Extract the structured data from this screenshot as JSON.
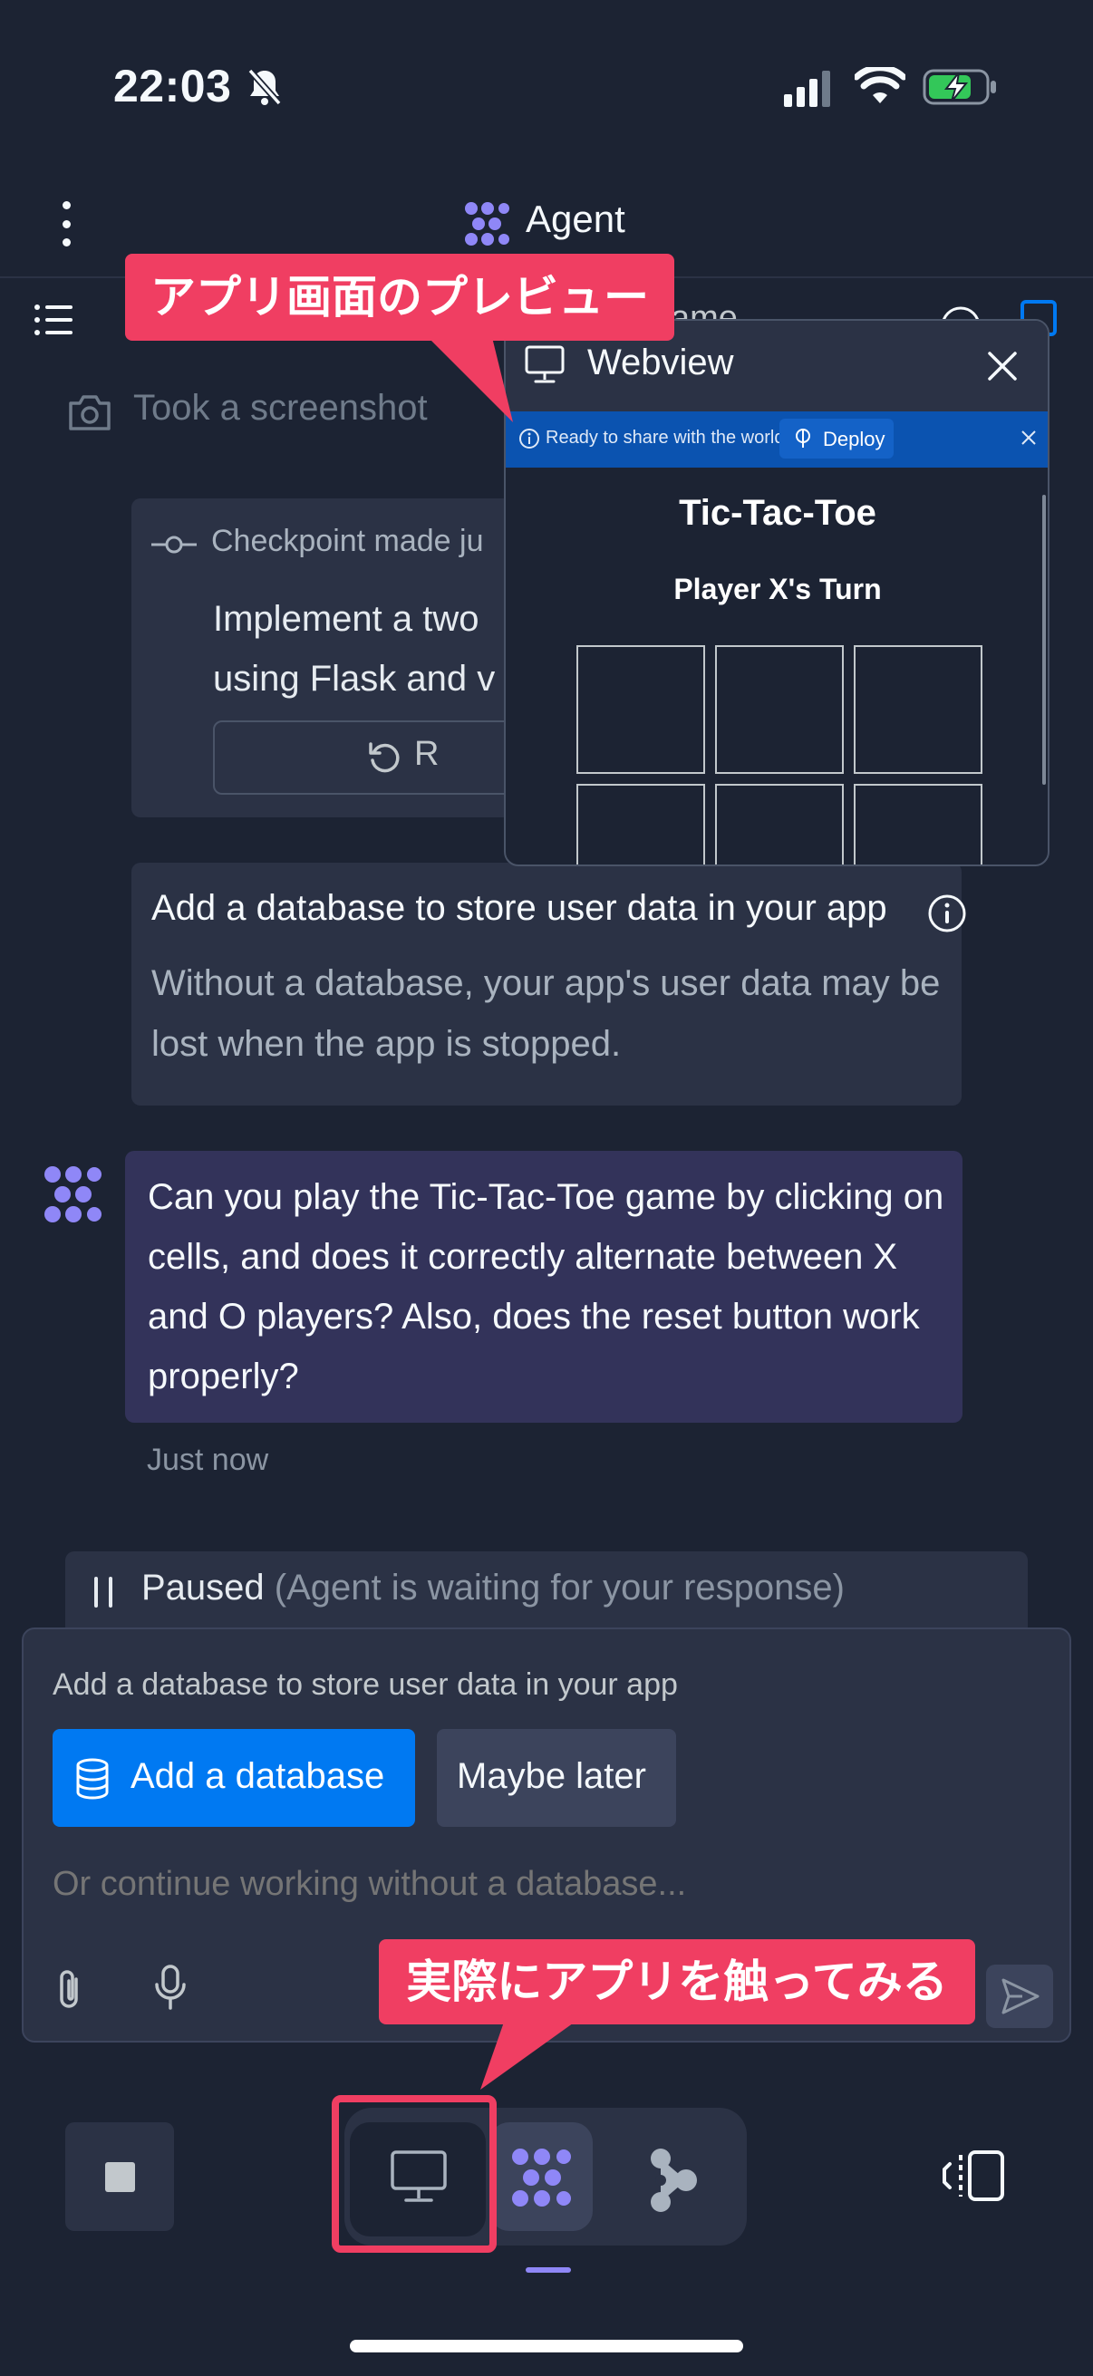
{
  "status_bar": {
    "time": "22:03"
  },
  "header": {
    "title": "Agent"
  },
  "subheader": {
    "visible_text": "ame"
  },
  "tool_action": {
    "label": "Took a screenshot"
  },
  "checkpoint": {
    "label": "Checkpoint made ju",
    "description_line1": "Implement a two",
    "description_line2": "using Flask and v",
    "rollback_label": "R"
  },
  "db_suggestion": {
    "title": "Add a database to store user data in your app",
    "description": "Without a database, your app's user data may be lost when the app is stopped."
  },
  "agent_message": {
    "text": "Can you play the Tic-Tac-Toe game by clicking on cells, and does it correctly alternate between X and O players? Also, does the reset button work properly?",
    "time": "Just now"
  },
  "paused": {
    "label": "Paused",
    "sub": "(Agent is waiting for your response)"
  },
  "input_panel": {
    "title": "Add a database to store user data in your app",
    "add_db_label": "Add a database",
    "maybe_later_label": "Maybe later",
    "placeholder": "Or continue working without a database..."
  },
  "webview": {
    "title": "Webview",
    "banner_text": "Ready to share with the world?",
    "deploy_label": "Deploy",
    "game_title": "Tic-Tac-Toe",
    "turn_text": "Player X's Turn"
  },
  "callouts": {
    "top": "アプリ画面のプレビュー",
    "bottom": "実際にアプリを触ってみる"
  },
  "colors": {
    "background": "#1c2333",
    "card": "#2b3245",
    "accent_blue": "#0079f2",
    "agent_purple": "#8f87f7",
    "callout_pink": "#f03e62",
    "battery_green": "#33c759"
  },
  "icons": [
    "bell-slash-icon",
    "signal-icon",
    "wifi-icon",
    "battery-charging-icon",
    "more-vertical-icon",
    "agent-logo-icon",
    "list-icon",
    "info-icon",
    "camera-icon",
    "commit-icon",
    "rollback-icon",
    "database-icon",
    "paperclip-icon",
    "microphone-icon",
    "send-icon",
    "stop-icon",
    "monitor-icon",
    "deploy-icon",
    "swap-panels-icon",
    "close-icon"
  ]
}
